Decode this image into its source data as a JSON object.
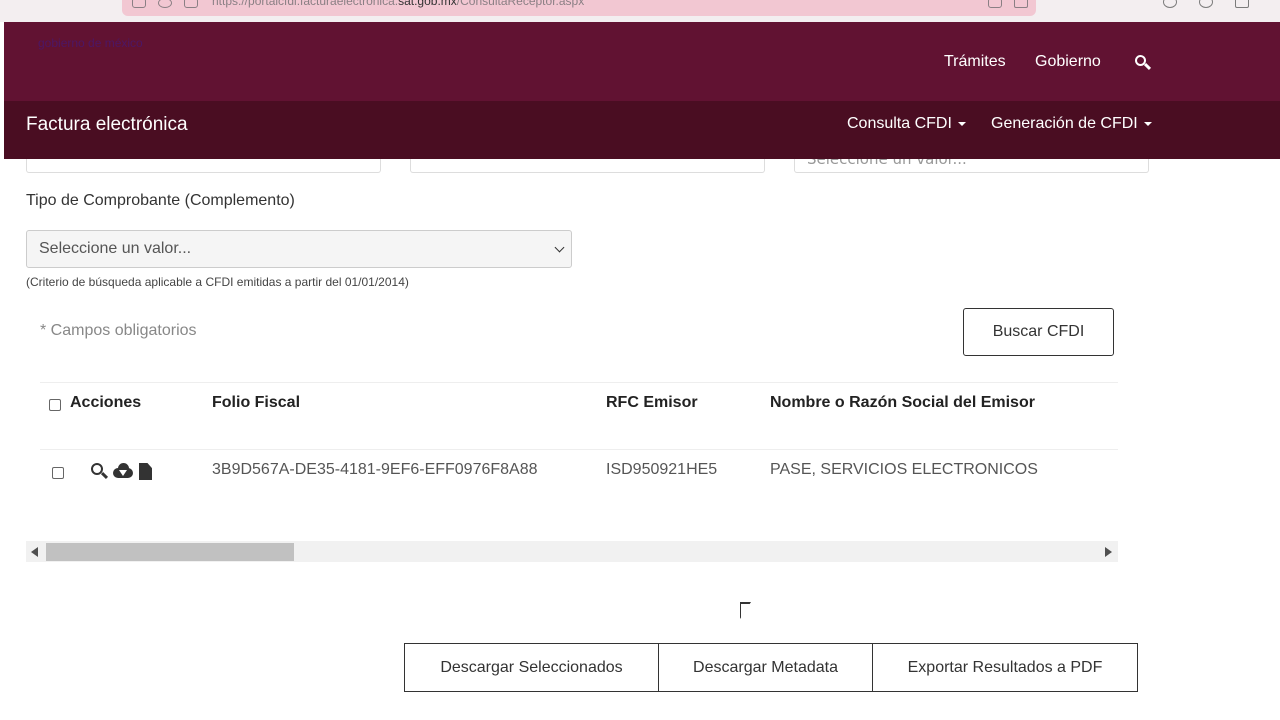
{
  "browser": {
    "url_prefix": "https://portalcfdi.facturaelectronica.",
    "url_domain": "sat.gob.mx",
    "url_path": "/ConsultaReceptor.aspx"
  },
  "gov_header": {
    "logo_text": "gobierno de méxico",
    "nav": [
      "Trámites",
      "Gobierno"
    ],
    "bg_color": "#611232"
  },
  "sub_header": {
    "title": "Factura electrónica",
    "menus": [
      "Consulta CFDI",
      "Generación de CFDI"
    ],
    "bg_color": "#4a0d22"
  },
  "filters": {
    "cut_placeholder": "Seleccione un valor...",
    "tipo_label": "Tipo de Comprobante (Complemento)",
    "tipo_value": "Seleccione un valor...",
    "hint": "(Criterio de búsqueda aplicable a CFDI emitidas a partir del 01/01/2014)",
    "required_note": "* Campos obligatorios",
    "search_button": "Buscar CFDI"
  },
  "table": {
    "headers": [
      "Acciones",
      "Folio Fiscal",
      "RFC Emisor",
      "Nombre o Razón Social del Emisor"
    ],
    "rows": [
      {
        "folio": "3B9D567A-DE35-4181-9EF6-EFF0976F8A88",
        "rfc": "ISD950921HE5",
        "nombre": "PASE, SERVICIOS ELECTRONICOS"
      }
    ],
    "scroll_position": 0.0
  },
  "actions": {
    "download_selected": "Descargar Seleccionados",
    "download_metadata": "Descargar Metadata",
    "export_pdf": "Exportar Resultados a PDF"
  },
  "icons": {
    "row": [
      "zoom-icon",
      "cloud-download-icon",
      "document-icon"
    ],
    "header": [
      "search-icon"
    ]
  }
}
